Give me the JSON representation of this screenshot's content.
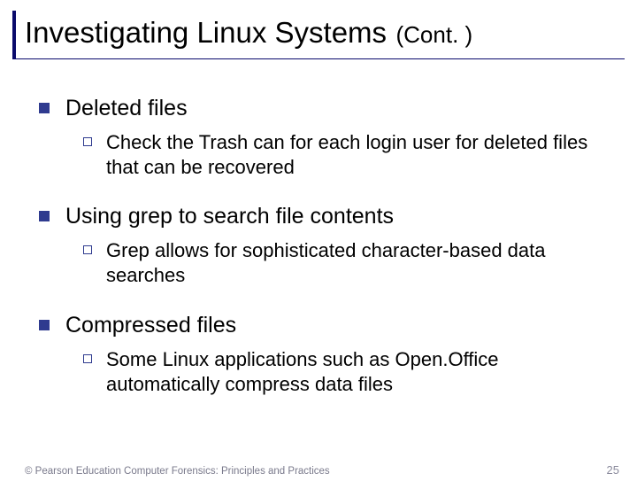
{
  "title": {
    "main": "Investigating Linux Systems",
    "cont": "(Cont. )"
  },
  "sections": [
    {
      "heading": "Deleted files",
      "sub": "Check the Trash can for each login user for deleted files that can be recovered"
    },
    {
      "heading": "Using grep to search file contents",
      "sub": "Grep allows for sophisticated character-based data searches"
    },
    {
      "heading": "Compressed files",
      "sub": "Some Linux applications such as Open.Office automatically compress data files"
    }
  ],
  "footer": {
    "copyright": "© Pearson Education  Computer Forensics: Principles and Practices",
    "page": "25"
  }
}
